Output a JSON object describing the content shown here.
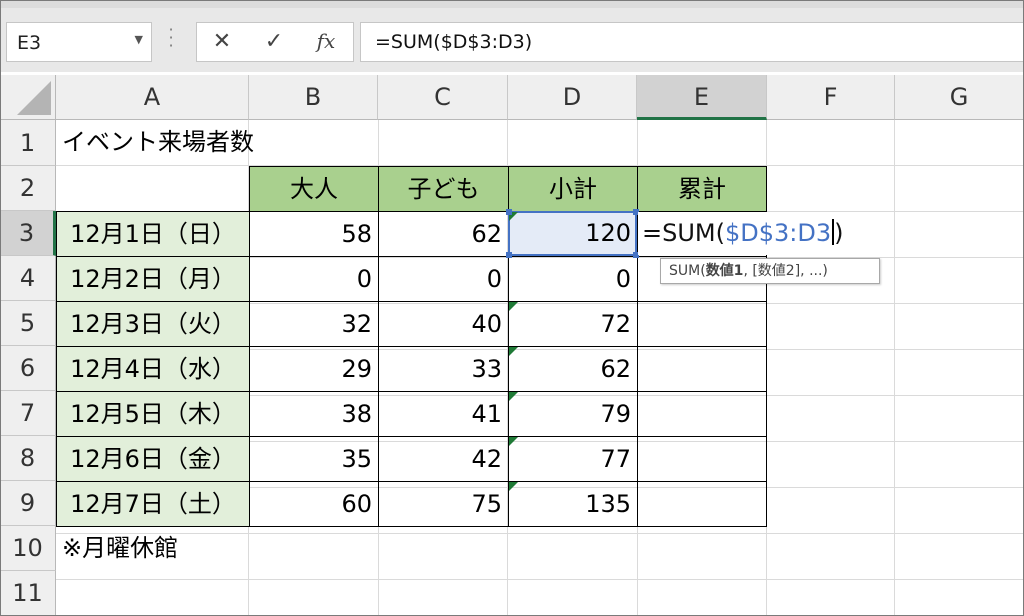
{
  "name_box": {
    "value": "E3"
  },
  "formula_bar": {
    "cancel_glyph": "✕",
    "enter_glyph": "✓",
    "fx_glyph": "fx",
    "formula": "=SUM($D$3:D3)"
  },
  "columns": [
    "A",
    "B",
    "C",
    "D",
    "E",
    "F",
    "G"
  ],
  "rows": [
    "1",
    "2",
    "3",
    "4",
    "5",
    "6",
    "7",
    "8",
    "9",
    "10",
    "11"
  ],
  "sheet": {
    "title": "イベント来場者数",
    "headers": {
      "b": "大人",
      "c": "子ども",
      "d": "小計",
      "e": "累計"
    },
    "data": [
      {
        "date": "12月1日（日）",
        "adult": "58",
        "child": "62",
        "subtotal": "120"
      },
      {
        "date": "12月2日（月）",
        "adult": "0",
        "child": "0",
        "subtotal": "0"
      },
      {
        "date": "12月3日（火）",
        "adult": "32",
        "child": "40",
        "subtotal": "72"
      },
      {
        "date": "12月4日（水）",
        "adult": "29",
        "child": "33",
        "subtotal": "62"
      },
      {
        "date": "12月5日（木）",
        "adult": "38",
        "child": "41",
        "subtotal": "79"
      },
      {
        "date": "12月6日（金）",
        "adult": "35",
        "child": "42",
        "subtotal": "77"
      },
      {
        "date": "12月7日（土）",
        "adult": "60",
        "child": "75",
        "subtotal": "135"
      }
    ],
    "note": "※月曜休館"
  },
  "editing": {
    "prefix": "=SUM(",
    "reference": "$D$3:D3",
    "suffix": ")"
  },
  "tooltip": {
    "func": "SUM(",
    "arg1": "数値1",
    "rest": ", [数値2], ...)"
  },
  "colors": {
    "header_fill": "#a9d08e",
    "date_fill": "#e2efda",
    "reference_blue": "#4472c4",
    "excel_green": "#217346"
  }
}
